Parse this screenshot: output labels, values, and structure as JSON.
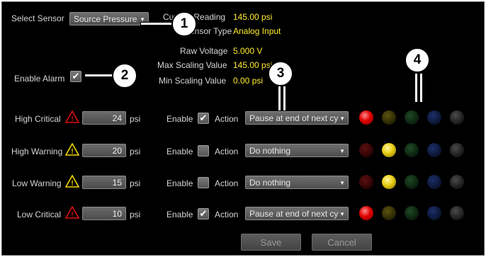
{
  "sensor": {
    "label": "Select Sensor",
    "selected": "Source Pressure"
  },
  "info": {
    "current_reading_label": "Current Reading",
    "current_reading_value": "145.00 psi",
    "sensor_type_label": "Sensor Type",
    "sensor_type_value": "Analog Input",
    "raw_voltage_label": "Raw Voltage",
    "raw_voltage_value": "5.000 V",
    "max_scaling_label": "Max Scaling Value",
    "max_scaling_value": "145.00 psi",
    "min_scaling_label": "Min Scaling Value",
    "min_scaling_value": "0.00 psi"
  },
  "enable_alarm": {
    "label": "Enable Alarm",
    "checked": true
  },
  "rows": [
    {
      "label": "High Critical",
      "icon": "warning-icon-red",
      "value": "24",
      "unit": "psi",
      "enable_label": "Enable",
      "enabled": true,
      "action_label": "Action",
      "action": "Pause at end of next cy",
      "leds": [
        "red-on",
        "yellow-off",
        "green-off",
        "blue-off",
        "dark-off"
      ]
    },
    {
      "label": "High Warning",
      "icon": "warning-icon-yellow",
      "value": "20",
      "unit": "psi",
      "enable_label": "Enable",
      "enabled": false,
      "action_label": "Action",
      "action": "Do nothing",
      "leds": [
        "red-off",
        "yellow-on",
        "green-off",
        "blue-off",
        "dark-off"
      ]
    },
    {
      "label": "Low Warning",
      "icon": "warning-icon-yellow",
      "value": "15",
      "unit": "psi",
      "enable_label": "Enable",
      "enabled": false,
      "action_label": "Action",
      "action": "Do nothing",
      "leds": [
        "red-off",
        "yellow-on",
        "green-off",
        "blue-off",
        "dark-off"
      ]
    },
    {
      "label": "Low Critical",
      "icon": "warning-icon-red",
      "value": "10",
      "unit": "psi",
      "enable_label": "Enable",
      "enabled": true,
      "action_label": "Action",
      "action": "Pause at end of next cy",
      "leds": [
        "red-on",
        "yellow-off",
        "green-off",
        "blue-off",
        "dark-off"
      ]
    }
  ],
  "buttons": {
    "save": "Save",
    "cancel": "Cancel"
  },
  "callouts": [
    "1",
    "2",
    "3",
    "4"
  ],
  "colors": {
    "value_text": "#ffec2e",
    "panel_bg": "#000000",
    "red_warning": "#e01010",
    "yellow_warning": "#f0d800"
  }
}
